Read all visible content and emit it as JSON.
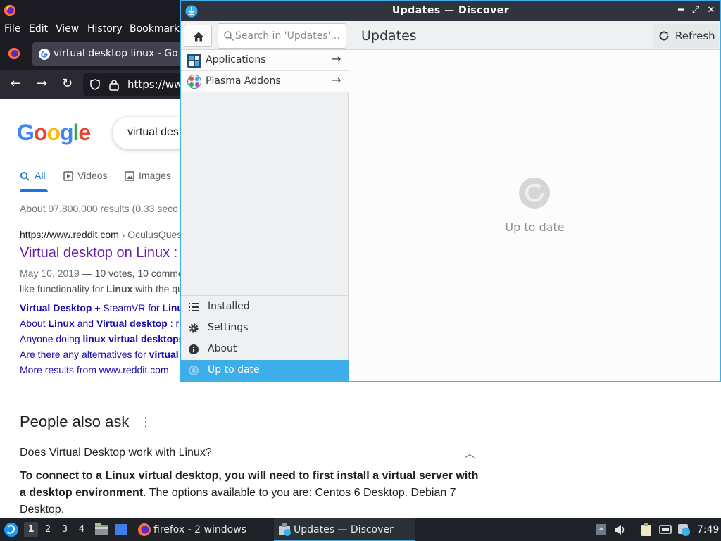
{
  "colors": {
    "accent": "#3daee9",
    "firefox_dark": "#1c1b22",
    "google_link": "#1a0dab",
    "google_visited": "#681da8"
  },
  "firefox": {
    "menu": [
      "File",
      "Edit",
      "View",
      "History",
      "Bookmarks"
    ],
    "tab_title": "virtual desktop linux - Go",
    "url": "https://ww",
    "icons": [
      "firefox-icon",
      "back-icon",
      "forward-icon",
      "reload-icon",
      "shield-icon",
      "lock-icon"
    ]
  },
  "google": {
    "logo_letters": [
      "G",
      "o",
      "o",
      "g",
      "l",
      "e"
    ],
    "query": "virtual des",
    "tabs": [
      {
        "label": "All",
        "active": true
      },
      {
        "label": "Videos",
        "active": false
      },
      {
        "label": "Images",
        "active": false
      }
    ],
    "stats": "About 97,800,000 results (0.33 seco",
    "result": {
      "cite_domain": "https://www.reddit.com",
      "cite_path": " › OculusQues",
      "title": "Virtual desktop on Linux :",
      "date": "May 10, 2019",
      "snippet1": " — 10 votes, 10 comme",
      "snippet2_pre": "like functionality for ",
      "snippet2_bold": "Linux",
      "snippet2_post": " with the qu",
      "sublinks": [
        {
          "b1": "Virtual Desktop",
          "t1": " + SteamVR for ",
          "b2": "Linu",
          "t2": ""
        },
        {
          "b1": "",
          "t1": "About ",
          "b2": "Linux",
          "t2": " and "
        },
        {
          "b1": "",
          "t1": "Anyone doing ",
          "b2": "linux virtual desktops",
          "t2": ""
        },
        {
          "b1": "",
          "t1": "Are there any alternatives for ",
          "b2": "virtual",
          "t2": ""
        }
      ],
      "sublink1_extra_bold": "Virtual desktop",
      "sublink1_extra_tail": " : r",
      "more_results": "More results from www.reddit.com"
    },
    "paa_title": "People also ask",
    "paa_question": "Does Virtual Desktop work with Linux?",
    "answer_bold": "To connect to a Linux virtual desktop, you will need to first install a virtual server with a desktop environment",
    "answer_rest": ". The options available to you are: Centos 6 Desktop. Debian 7 Desktop."
  },
  "discover": {
    "window_title": "Updates — Discover",
    "search_placeholder": "Search in 'Updates'...",
    "page_title": "Updates",
    "refresh_label": "Refresh",
    "categories": [
      {
        "label": "Applications",
        "icon": "applications-icon"
      },
      {
        "label": "Plasma Addons",
        "icon": "plasma-addons-icon"
      }
    ],
    "nav": [
      {
        "label": "Installed",
        "icon": "list-icon",
        "selected": false
      },
      {
        "label": "Settings",
        "icon": "gear-icon",
        "selected": false
      },
      {
        "label": "About",
        "icon": "info-icon",
        "selected": false
      },
      {
        "label": "Up to date",
        "icon": "update-status-icon",
        "selected": true
      }
    ],
    "status_text": "Up to date"
  },
  "taskbar": {
    "workspaces": [
      "1",
      "2",
      "3",
      "4"
    ],
    "active_workspace": "1",
    "tasks": [
      {
        "label": "firefox - 2 windows",
        "icon": "firefox-icon"
      },
      {
        "label": "Updates — Discover",
        "icon": "discover-icon",
        "active": true
      }
    ],
    "clock": "7:49"
  }
}
